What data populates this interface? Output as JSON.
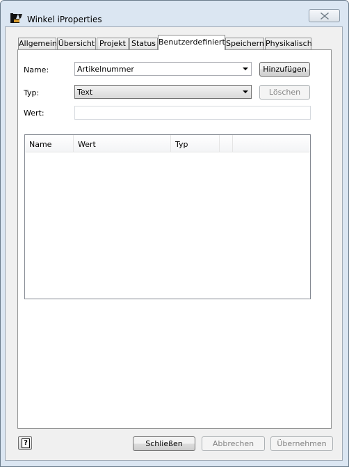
{
  "window": {
    "title": "Winkel iProperties"
  },
  "tabs": [
    {
      "label": "Allgemein"
    },
    {
      "label": "Übersicht"
    },
    {
      "label": "Projekt"
    },
    {
      "label": "Status"
    },
    {
      "label": "Benutzerdefiniert",
      "active": true
    },
    {
      "label": "Speichern"
    },
    {
      "label": "Physikalisch"
    }
  ],
  "form": {
    "name_label": "Name:",
    "name_value": "Artikelnummer",
    "type_label": "Typ:",
    "type_value": "Text",
    "value_label": "Wert:",
    "value_value": "",
    "add_button": "Hinzufügen",
    "delete_button": "Löschen"
  },
  "table": {
    "columns": [
      "Name",
      "Wert",
      "Typ",
      ""
    ],
    "rows": []
  },
  "footer": {
    "close_button": "Schließen",
    "cancel_button": "Abbrechen",
    "apply_button": "Übernehmen"
  },
  "icons": {
    "app": "inventor-part-icon",
    "close": "close-icon",
    "help": "help-icon"
  }
}
